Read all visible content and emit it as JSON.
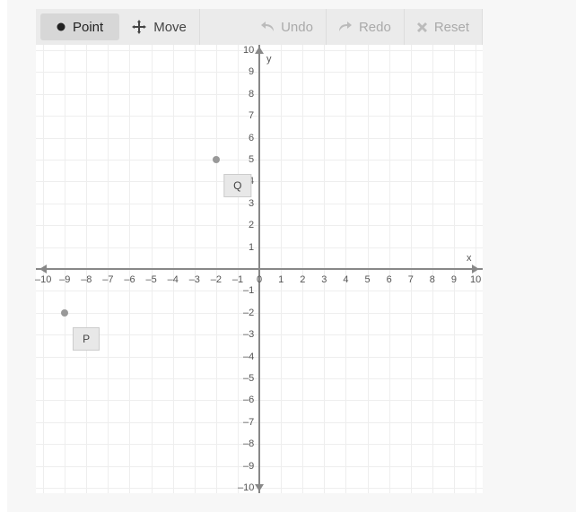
{
  "toolbar": {
    "point_label": "Point",
    "move_label": "Move",
    "undo_label": "Undo",
    "redo_label": "Redo",
    "reset_label": "Reset"
  },
  "chart_data": {
    "type": "scatter",
    "xlabel": "x",
    "ylabel": "y",
    "xlim": [
      -10,
      10
    ],
    "ylim": [
      -10,
      10
    ],
    "x_ticks": [
      -10,
      -9,
      -8,
      -7,
      -6,
      -5,
      -4,
      -3,
      -2,
      -1,
      0,
      1,
      2,
      3,
      4,
      5,
      6,
      7,
      8,
      9,
      10
    ],
    "y_ticks": [
      -10,
      -9,
      -8,
      -7,
      -6,
      -5,
      -4,
      -3,
      -2,
      -1,
      1,
      2,
      3,
      4,
      5,
      6,
      7,
      8,
      9,
      10
    ],
    "series": [
      {
        "name": "Q",
        "x": -2,
        "y": 5
      },
      {
        "name": "P",
        "x": -9,
        "y": -2
      }
    ]
  }
}
